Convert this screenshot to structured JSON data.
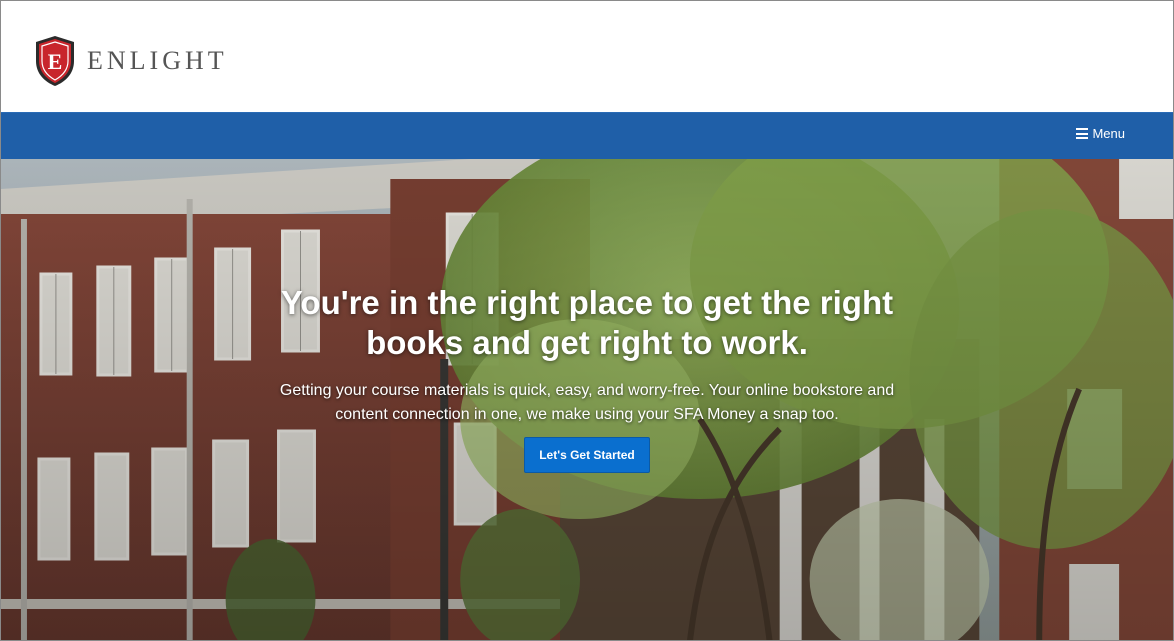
{
  "brand": {
    "shield_letter": "E",
    "name": "ENLIGHT",
    "primary_color": "#1f5fa8",
    "shield_color": "#c8262c"
  },
  "nav": {
    "menu_label": "Menu",
    "menu_icon": "hamburger-icon"
  },
  "hero": {
    "title": "You're in the right place to get the right books and get right to work.",
    "subtitle": "Getting your course materials is quick, easy, and worry-free. Your online bookstore and content connection in one, we make using your SFA Money a snap too.",
    "cta_label": "Let's Get Started",
    "cta_color": "#0a6fcf"
  }
}
